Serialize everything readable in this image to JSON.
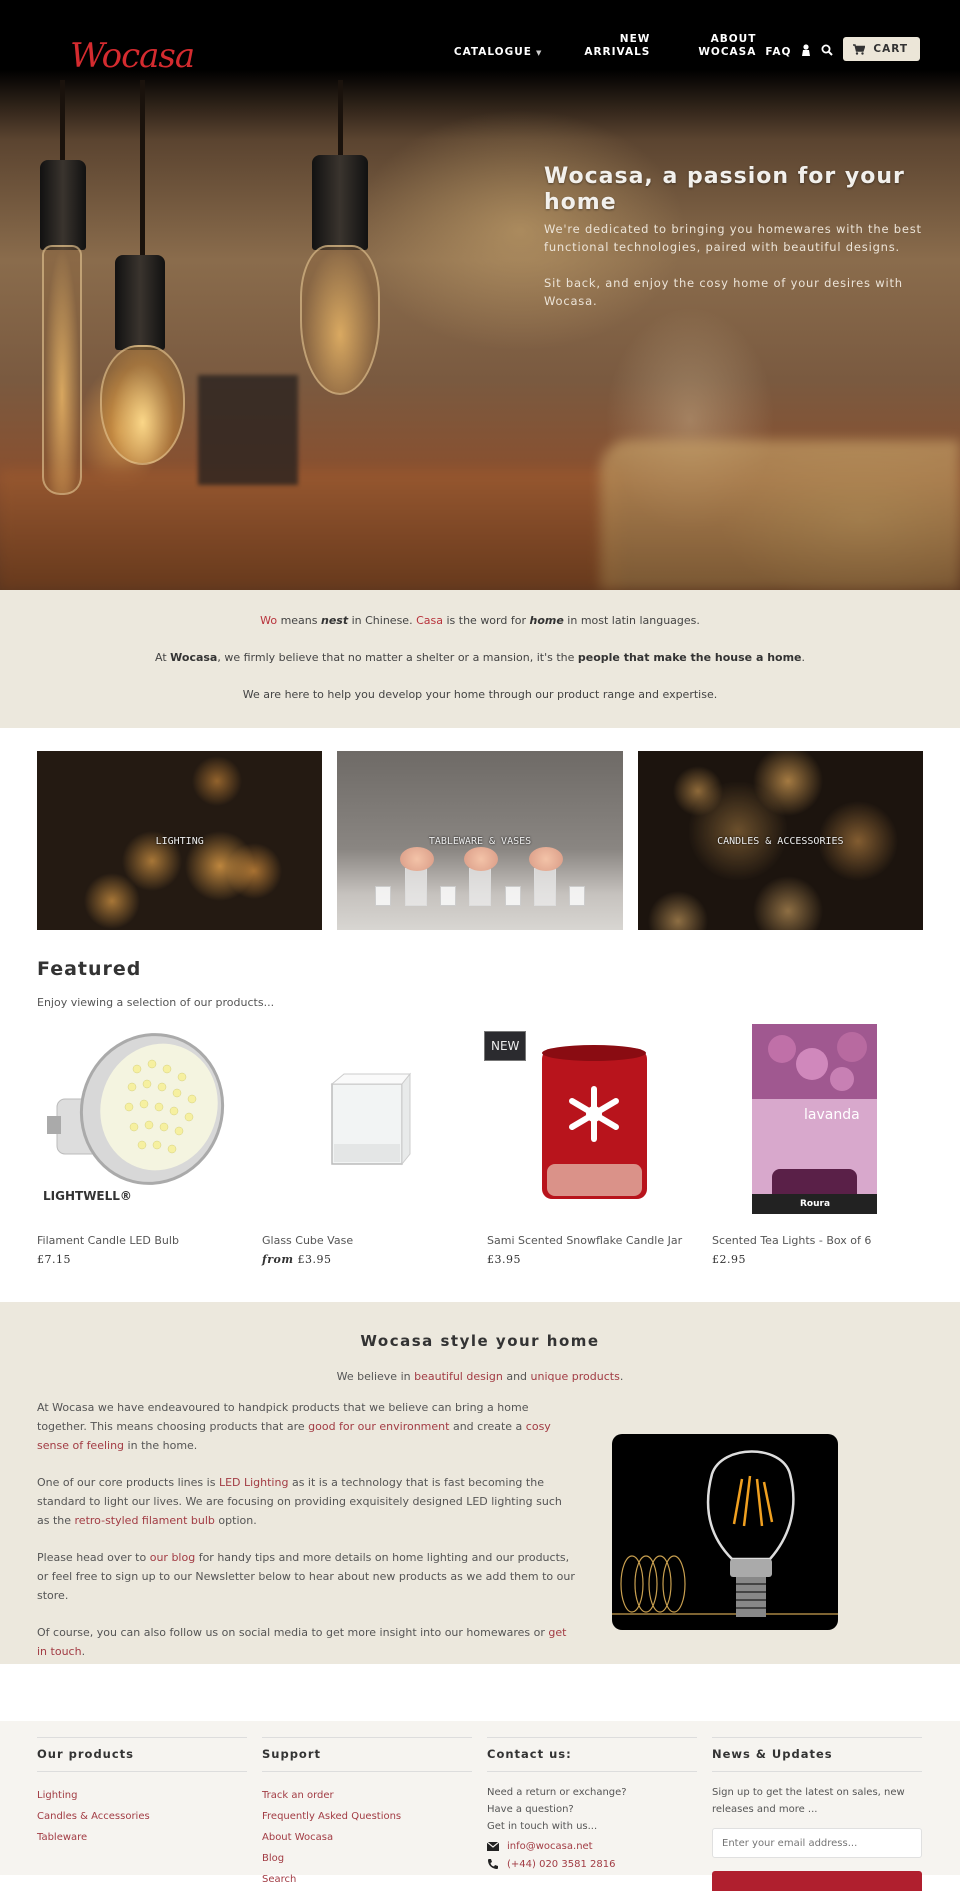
{
  "header": {
    "logo": "Wocasa",
    "nav": {
      "catalogue": "CATALOGUE",
      "new_arrivals_line1": "NEW",
      "new_arrivals_line2": "ARRIVALS",
      "about_line1": "ABOUT",
      "about_line2": "WOCASA",
      "faq": "FAQ",
      "cart": "CART"
    }
  },
  "hero": {
    "title": "Wocasa, a passion for your home",
    "subtitle": "We're dedicated to bringing you homewares with the best functional technologies, paired with beautiful designs.",
    "subtitle2": "Sit back, and enjoy the cosy home of your desires with Wocasa."
  },
  "intro": {
    "line1": {
      "wo": "Wo",
      "t1": " means ",
      "nest": "nest",
      "t2": " in Chinese. ",
      "casa": "Casa",
      "t3": " is the word for ",
      "home": "home",
      "t4": " in most latin languages."
    },
    "line2": {
      "t1": "At ",
      "brand": "Wocasa",
      "t2": ", we firmly believe that no matter a shelter or a mansion, it's the ",
      "bold": "people that make the house a home",
      "t3": "."
    },
    "line3": "We are here to help you develop your home through our product range and expertise."
  },
  "categories": [
    {
      "label": "LIGHTING"
    },
    {
      "label": "TABLEWARE & VASES"
    },
    {
      "label": "CANDLES & ACCESSORIES"
    }
  ],
  "featured": {
    "title": "Featured",
    "subtitle": "Enjoy viewing a selection of our products...",
    "products": [
      {
        "name": "Filament Candle LED Bulb",
        "price_prefix": "",
        "price": "£7.15",
        "brand": "LIGHTWELL®",
        "badge": ""
      },
      {
        "name": "Glass Cube Vase",
        "price_prefix": "from",
        "price": "£3.95",
        "badge": ""
      },
      {
        "name": "Sami Scented Snowflake Candle Jar",
        "price_prefix": "",
        "price": "£3.95",
        "badge": "NEW"
      },
      {
        "name": "Scented Tea Lights - Box of 6",
        "price_prefix": "",
        "price": "£2.95",
        "box_title": "lavanda",
        "box_brand": "Roura",
        "badge": ""
      }
    ]
  },
  "style_section": {
    "title": "Wocasa style your home",
    "tagline": {
      "t1": "We believe in ",
      "l1": "beautiful design",
      "t2": " and ",
      "l2": "unique products",
      "t3": "."
    },
    "p1": {
      "t1": "At Wocasa we have endeavoured to handpick products that we believe can bring a home together. This means choosing products that are ",
      "l1": "good for our environment",
      "t2": " and create a ",
      "l2": "cosy sense of feeling",
      "t3": " in the home."
    },
    "p2": {
      "t1": "One of our core products lines is ",
      "l1": "LED Lighting",
      "t2": " as it is a technology that is fast becoming the standard to light our lives. We are focusing on providing exquisitely designed LED lighting such as the ",
      "l2": "retro-styled filament bulb",
      "t3": " option."
    },
    "p3": {
      "t1": "Please head over to ",
      "l1": "our blog",
      "t2": " for handy tips and more details on home lighting and our products, or feel free to sign up to our Newsletter below to hear about new products as we add them to our store."
    },
    "p4": {
      "t1": "Of course, you can also follow us on social media to get more insight into our homewares or ",
      "l1": "get in touch",
      "t2": "."
    }
  },
  "footer": {
    "products": {
      "title": "Our products",
      "links": [
        "Lighting",
        "Candles & Accessories",
        "Tableware"
      ]
    },
    "support": {
      "title": "Support",
      "links": [
        "Track an order",
        "Frequently Asked Questions",
        "About Wocasa",
        "Blog",
        "Search"
      ]
    },
    "contact": {
      "title": "Contact us:",
      "lines": [
        "Need a return or exchange?",
        "Have a question?",
        "Get in touch with us..."
      ],
      "email": "info@wocasa.net",
      "phone": "(+44) 020 3581 2816"
    },
    "news": {
      "title": "News & Updates",
      "text": "Sign up to get the latest on sales, new releases and more ...",
      "placeholder": "Enter your email address..."
    }
  },
  "colors": {
    "brand_red": "#d42b2f",
    "link": "#a23c44",
    "beige": "#ece8dd",
    "button": "#b01f2e"
  }
}
